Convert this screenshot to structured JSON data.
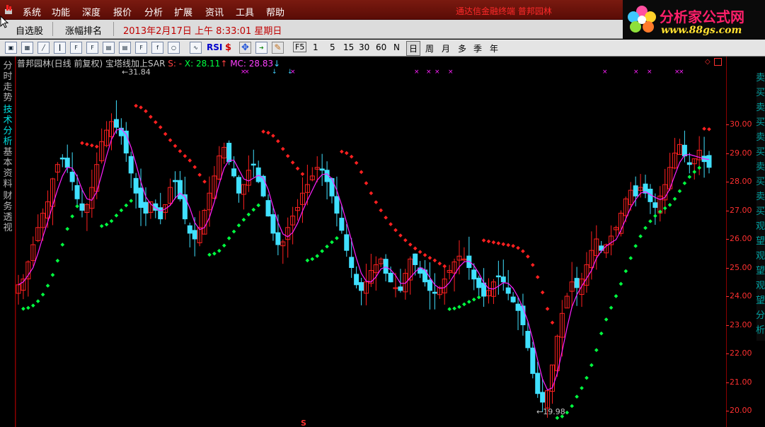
{
  "menubar": {
    "items": [
      "系统",
      "功能",
      "深度",
      "报价",
      "分析",
      "扩展",
      "资讯",
      "工具",
      "帮助"
    ],
    "promo": "通达信金融终端  普邦园林"
  },
  "logo": {
    "title": "分析家公式网",
    "url": "www.88gs.com"
  },
  "tabbar": {
    "tabs": [
      "自选股",
      "涨幅排名"
    ],
    "datetime": "2013年2月17日  上午  8:33:01  星期日"
  },
  "toolbar": {
    "icons": [
      "window-icon",
      "table-icon",
      "line-chart-icon",
      "candle-icon",
      "f10-icon",
      "profile-icon",
      "calendar-icon",
      "f10-info-icon",
      "formula-icon",
      "search-icon",
      "wave-icon"
    ],
    "rsi_label": "RSI",
    "dollar_label": "$",
    "f5_label": "F5",
    "periods": [
      "1",
      "5",
      "15",
      "30",
      "60",
      "N",
      "日",
      "周",
      "月",
      "多",
      "季",
      "年"
    ],
    "active_period": "日"
  },
  "left_tabs": [
    "分时走势",
    "技术分析",
    "基本资料",
    "财务透视"
  ],
  "active_left_tab": "技术分析",
  "chart_info": {
    "stock": "普邦园林(日线 前复权)",
    "indicator": "宝塔线加上SAR",
    "s_label": "S: -",
    "x_label": "X: 28.11",
    "x_arrow": "↑",
    "mc_label": "MC: 28.83",
    "mc_arrow": "↓"
  },
  "annotations": {
    "high": "31.84",
    "low": "19.98",
    "sell_marker": "S"
  },
  "right_signals": [
    "卖",
    "买",
    "卖",
    "买",
    "卖",
    "买",
    "卖",
    "买",
    "卖",
    "买",
    "观",
    "望",
    "观",
    "望",
    "观",
    "望",
    "分",
    "析"
  ],
  "colors": {
    "up": "#ff2020",
    "down": "#40e0ff",
    "sar_up": "#00ff40",
    "sar_down": "#ff2020",
    "ma": "#ff20ff"
  },
  "chart_data": {
    "type": "candlestick",
    "title": "普邦园林(日线 前复权)",
    "indicator": "宝塔线加上SAR",
    "y_ticks": [
      30.0,
      29.0,
      28.0,
      27.0,
      26.0,
      25.0,
      24.0,
      23.0,
      22.0,
      21.0,
      20.0
    ],
    "ylim": [
      19.6,
      31.9
    ],
    "high_annotation": 31.84,
    "low_annotation": 19.98,
    "close_path": [
      24.4,
      24.6,
      25.2,
      25.8,
      26.4,
      26.9,
      27.3,
      28.1,
      28.6,
      28.8,
      28.5,
      28.0,
      27.4,
      27.0,
      27.2,
      27.8,
      28.6,
      29.4,
      29.8,
      30.1,
      29.9,
      29.6,
      29.0,
      28.3,
      27.6,
      27.1,
      26.9,
      27.3,
      27.0,
      26.7,
      27.2,
      27.8,
      28.0,
      27.4,
      26.7,
      26.2,
      26.0,
      26.4,
      27.0,
      27.6,
      28.2,
      28.9,
      29.2,
      28.7,
      28.2,
      27.6,
      27.9,
      28.4,
      28.6,
      28.0,
      27.5,
      26.8,
      26.2,
      25.8,
      25.9,
      26.4,
      26.8,
      27.1,
      27.6,
      27.9,
      28.2,
      28.5,
      28.4,
      28.0,
      27.5,
      26.9,
      26.3,
      25.6,
      25.0,
      24.4,
      24.2,
      24.5,
      24.9,
      25.1,
      25.3,
      24.8,
      24.5,
      24.3,
      24.2,
      24.8,
      25.3,
      25.1,
      24.8,
      24.5,
      24.2,
      24.1,
      24.3,
      24.6,
      24.9,
      25.2,
      25.4,
      25.3,
      25.0,
      24.6,
      24.3,
      24.0,
      24.2,
      24.5,
      24.7,
      24.5,
      24.1,
      23.8,
      23.5,
      23.0,
      22.2,
      21.3,
      20.6,
      20.3,
      20.7,
      21.6,
      22.6,
      23.4,
      24.0,
      24.5,
      24.3,
      24.6,
      25.1,
      25.6,
      26.0,
      25.6,
      25.8,
      26.1,
      26.4,
      26.9,
      27.4,
      27.7,
      27.5,
      27.8,
      27.6,
      27.3,
      27.1,
      27.5,
      27.9,
      28.5,
      29.0,
      29.3,
      28.9,
      28.6,
      28.8,
      29.1,
      28.7,
      28.5
    ]
  }
}
